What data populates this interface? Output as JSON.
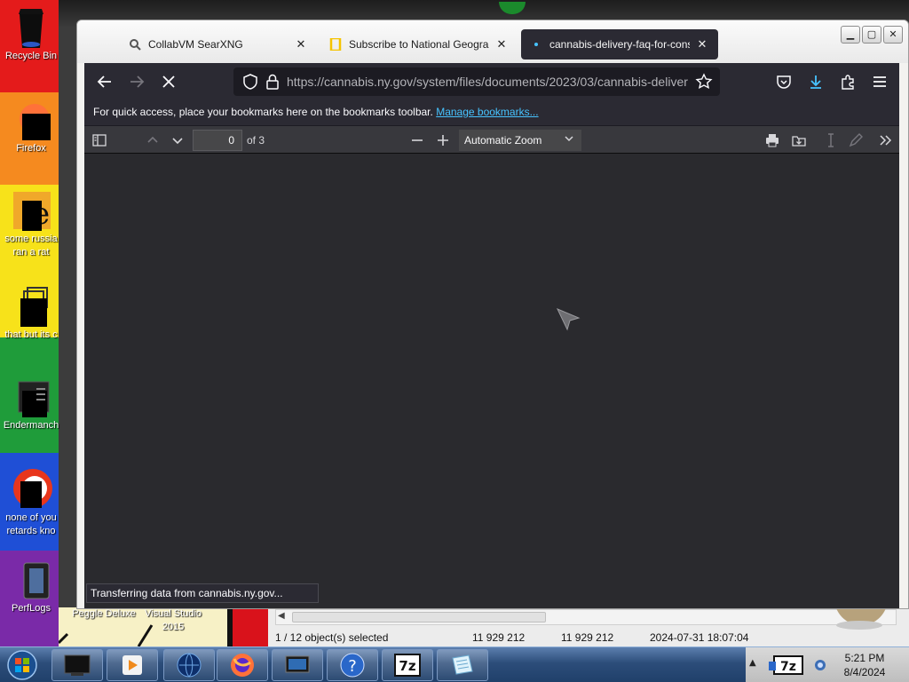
{
  "desktop": {
    "icons": [
      {
        "name": "recycle-bin",
        "label": "Recycle Bin"
      },
      {
        "name": "firefox",
        "label": "Firefox"
      },
      {
        "name": "some-russia",
        "label": "some russia",
        "label2": "ran a rat"
      },
      {
        "name": "that-but-its",
        "label": "that but its c"
      },
      {
        "name": "endermanch",
        "label": "Endermanch"
      },
      {
        "name": "none-of-you",
        "label": "none of you",
        "label2": "retards kno"
      },
      {
        "name": "perflogs",
        "label": "PerfLogs"
      },
      {
        "name": "peggle-deluxe",
        "label": "Peggle Deluxe"
      },
      {
        "name": "visual-studio",
        "label": "Visual Studio",
        "label2": "2015"
      }
    ]
  },
  "browser": {
    "tabs": [
      {
        "title": "CollabVM SearXNG",
        "active": false
      },
      {
        "title": "Subscribe to National Geograph",
        "active": false
      },
      {
        "title": "cannabis-delivery-faq-for-cons",
        "active": true
      }
    ],
    "url_host": "https://cannabis.ny.gov",
    "url_path": "/system/files/documents/2023/03/cannabis-deliver",
    "bookmarks_text": "For quick access, place your bookmarks here on the bookmarks toolbar.",
    "bookmarks_link": "Manage bookmarks...",
    "pdf": {
      "page_number": "0",
      "page_of": "of 3",
      "zoom": "Automatic Zoom"
    },
    "status_text": "Transferring data from cannabis.ny.gov..."
  },
  "explorer": {
    "selection": "1 / 12 object(s) selected",
    "size1": "11 929 212",
    "size2": "11 929 212",
    "modified": "2024-07-31 18:07:04"
  },
  "taskbar": {
    "time": "5:21 PM",
    "date": "8/4/2024"
  },
  "colors": {
    "firefox_dark": "#2b2a33",
    "pdf_viewer_bg": "#2a2a2e",
    "link": "#47c3ff",
    "taskbar": "#2c4d7a"
  }
}
